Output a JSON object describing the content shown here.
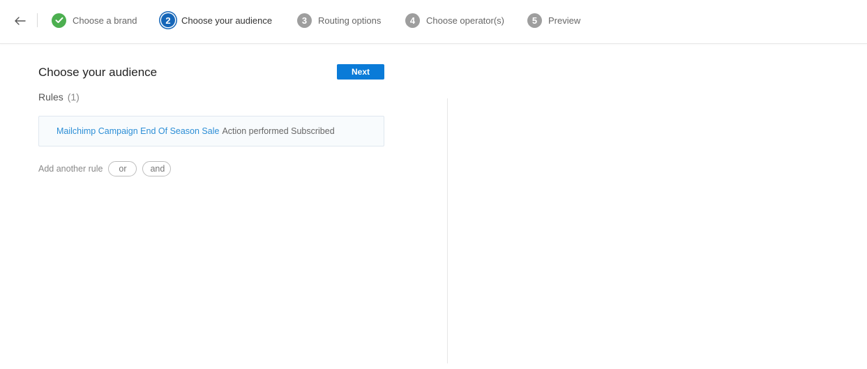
{
  "header": {
    "back_icon": "arrow-left-icon",
    "steps": [
      {
        "number": "1",
        "label": "Choose a brand",
        "state": "done",
        "icon": "check-icon"
      },
      {
        "number": "2",
        "label": "Choose your audience",
        "state": "active"
      },
      {
        "number": "3",
        "label": "Routing options",
        "state": "todo"
      },
      {
        "number": "4",
        "label": "Choose operator(s)",
        "state": "todo"
      },
      {
        "number": "5",
        "label": "Preview",
        "state": "todo"
      }
    ]
  },
  "main": {
    "title": "Choose your audience",
    "next_label": "Next",
    "rules_label": "Rules",
    "rules_count": "(1)",
    "rules": [
      {
        "link_text": "Mailchimp Campaign End Of Season Sale",
        "rest_text": "Action performed Subscribed"
      }
    ],
    "add_rule_label": "Add another rule",
    "or_label": "or",
    "and_label": "and"
  },
  "colors": {
    "accent": "#0a7bd8",
    "done": "#4caf50",
    "active_step": "#1566b8",
    "todo_step": "#9e9e9e",
    "link": "#2c8ed6"
  }
}
